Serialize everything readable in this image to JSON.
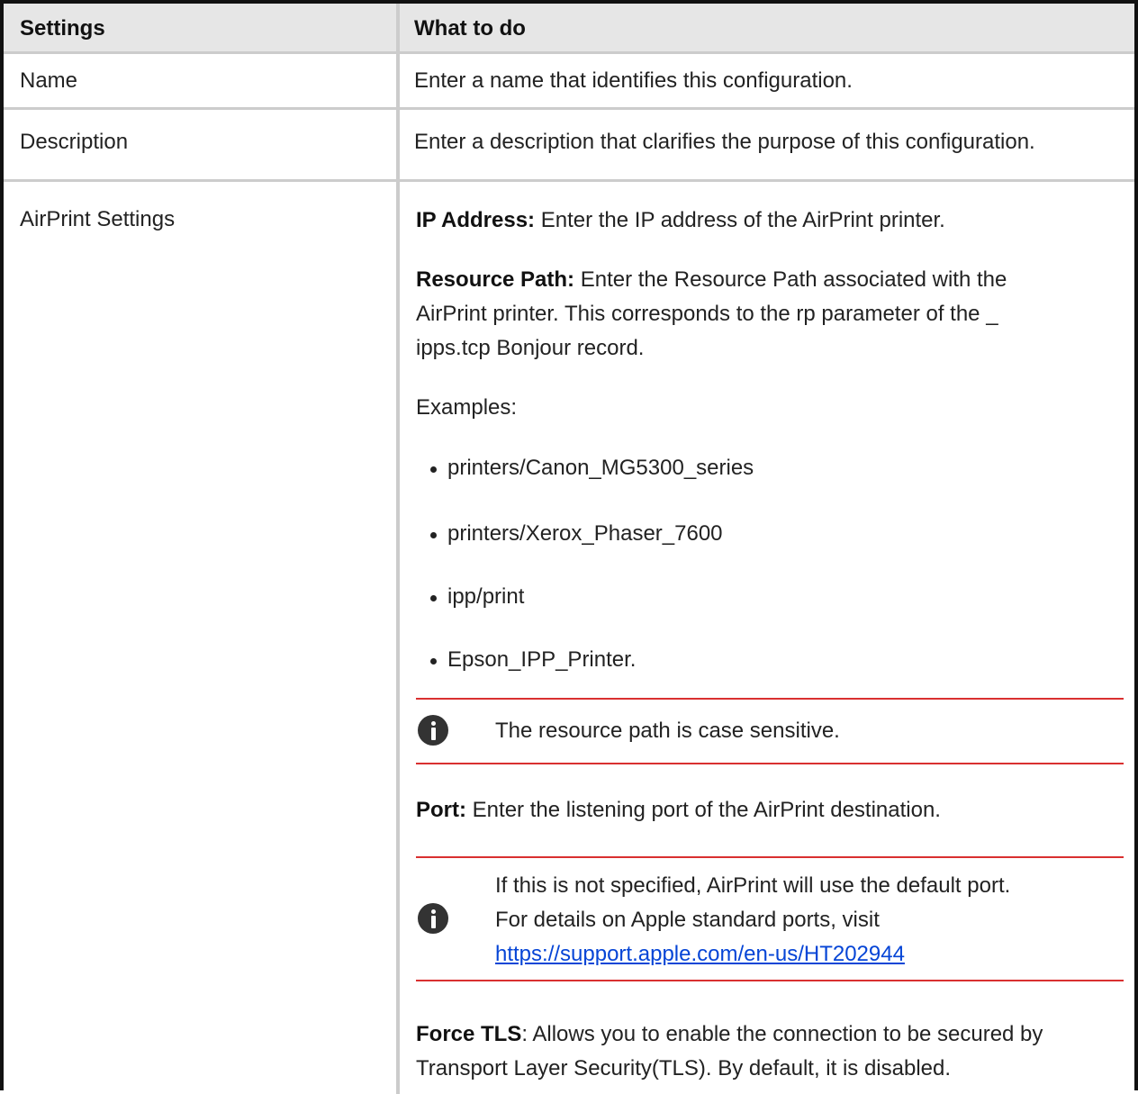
{
  "header": {
    "col1": "Settings",
    "col2": "What to do"
  },
  "rows": {
    "name": {
      "setting": "Name",
      "action": "Enter a name that identifies this configuration."
    },
    "description": {
      "setting": "Description",
      "action": "Enter a description that clarifies the purpose of this configuration."
    },
    "airprint": {
      "setting": "AirPrint Settings",
      "ip_label": "IP Address:",
      "ip_text": " Enter the IP address of the AirPrint printer.",
      "resource_label": "Resource Path:",
      "resource_line1": " Enter the Resource Path associated with the",
      "resource_line2": "AirPrint printer. This corresponds to the rp parameter of the _",
      "resource_line3": "ipps.tcp Bonjour record.",
      "examples_label": "Examples:",
      "examples": [
        "printers/Canon_MG5300_series",
        "printers/Xerox_Phaser_7600",
        "ipp/print",
        "Epson_IPP_Printer."
      ],
      "note1": "The resource path is case sensitive.",
      "port_label": "Port:",
      "port_text": " Enter the listening port of the AirPrint destination.",
      "note2_line1": "If this is not specified, AirPrint will use the default port.",
      "note2_line2": "For details on Apple standard ports, visit",
      "note2_link": "https://support.apple.com/en-us/HT202944",
      "tls_label": "Force TLS",
      "tls_line1": ": Allows you to enable the connection to be secured by",
      "tls_line2": "Transport Layer Security(TLS). By default, it is disabled."
    }
  },
  "colors": {
    "header_bg": "#e6e6e6",
    "divider": "#cccccc",
    "note_rule": "#d93030",
    "link": "#0645d6"
  },
  "icons": {
    "note": "info-icon"
  }
}
